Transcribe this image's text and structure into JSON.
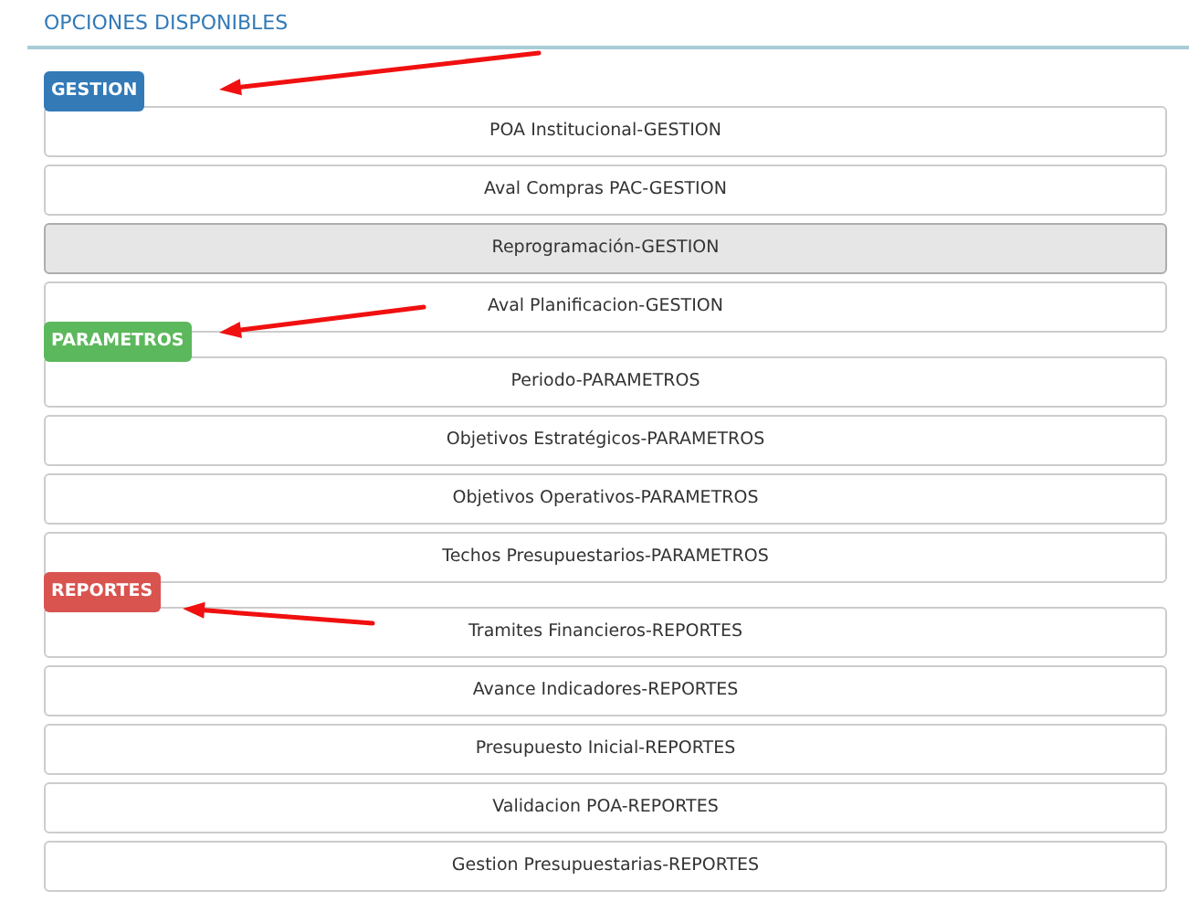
{
  "title": "OPCIONES DISPONIBLES",
  "groups": [
    {
      "label": "GESTION",
      "kind": "primary",
      "annotated": true,
      "options": [
        {
          "label": "POA Institucional-GESTION",
          "selected": false
        },
        {
          "label": "Aval Compras PAC-GESTION",
          "selected": false
        },
        {
          "label": "Reprogramación-GESTION",
          "selected": true
        },
        {
          "label": "Aval Planificacion-GESTION",
          "selected": false
        }
      ]
    },
    {
      "label": "PARAMETROS",
      "kind": "success",
      "annotated": true,
      "options": [
        {
          "label": "Periodo-PARAMETROS",
          "selected": false
        },
        {
          "label": "Objetivos Estratégicos-PARAMETROS",
          "selected": false
        },
        {
          "label": "Objetivos Operativos-PARAMETROS",
          "selected": false
        },
        {
          "label": "Techos Presupuestarios-PARAMETROS",
          "selected": false
        }
      ]
    },
    {
      "label": "REPORTES",
      "kind": "danger",
      "annotated": true,
      "options": [
        {
          "label": "Tramites Financieros-REPORTES",
          "selected": false
        },
        {
          "label": "Avance Indicadores-REPORTES",
          "selected": false
        },
        {
          "label": "Presupuesto Inicial-REPORTES",
          "selected": false
        },
        {
          "label": "Validacion POA-REPORTES",
          "selected": false
        },
        {
          "label": "Gestion Presupuestarias-REPORTES",
          "selected": false
        }
      ]
    }
  ]
}
